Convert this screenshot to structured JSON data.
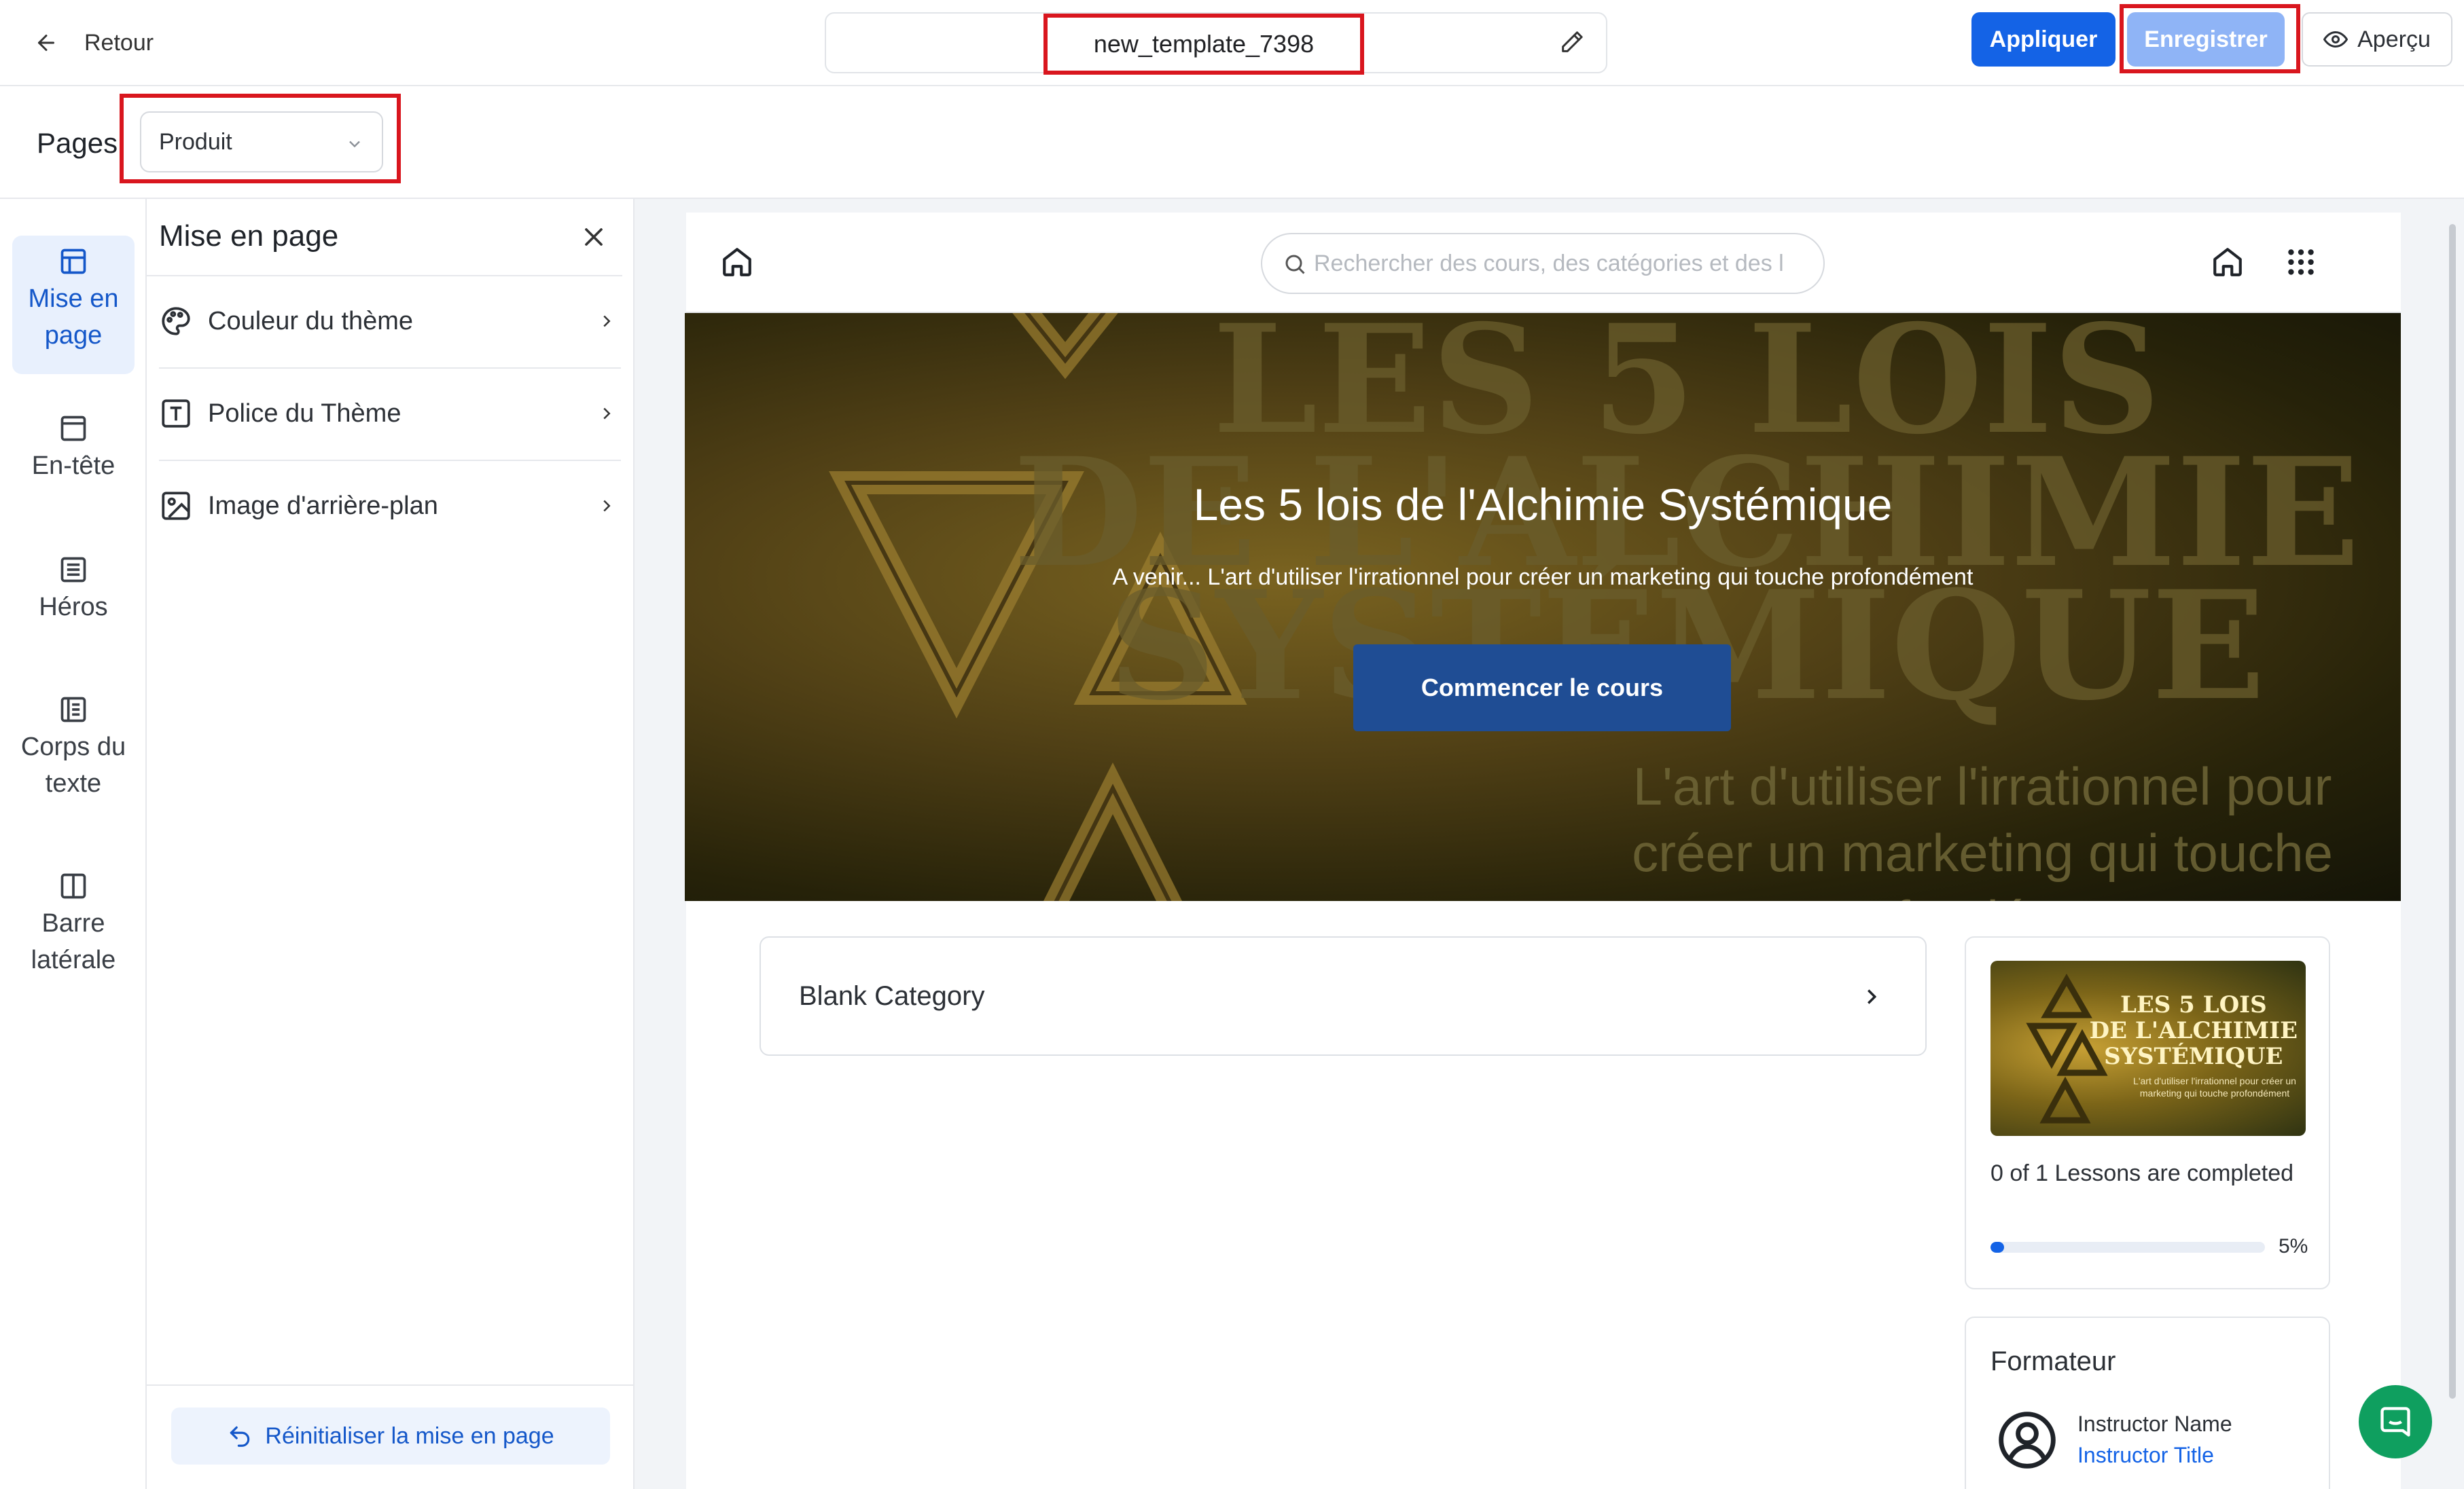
{
  "topbar": {
    "back_label": "Retour",
    "template_name": "new_template_7398",
    "apply_label": "Appliquer",
    "save_label": "Enregistrer",
    "preview_label": "Aperçu"
  },
  "pages": {
    "label": "Pages",
    "selected": "Produit"
  },
  "rail": {
    "items": [
      {
        "label": "Mise en page",
        "icon": "layout-icon",
        "active": true
      },
      {
        "label": "En-tête",
        "icon": "header-icon"
      },
      {
        "label": "Héros",
        "icon": "hero-icon"
      },
      {
        "label": "Corps du texte",
        "icon": "body-text-icon"
      },
      {
        "label": "Barre latérale",
        "icon": "sidebar-icon"
      }
    ]
  },
  "panel": {
    "title": "Mise en page",
    "rows": [
      {
        "label": "Couleur du thème",
        "icon": "palette-icon"
      },
      {
        "label": "Police du Thème",
        "icon": "font-icon"
      },
      {
        "label": "Image d'arrière-plan",
        "icon": "image-icon"
      }
    ],
    "reset_label": "Réinitialiser la mise en page"
  },
  "site": {
    "search_placeholder": "Rechercher des cours, des catégories et des l",
    "hero": {
      "bg_title_lines": [
        "LES 5 LOIS",
        "DE L'ALCHIMIE",
        "SYSTÉMIQUE"
      ],
      "bg_sub_lines": [
        "L'art d'utiliser l'irrationnel pour",
        "créer un marketing qui touche",
        "profondément"
      ],
      "title": "Les 5 lois de l'Alchimie Systémique",
      "subtitle": "A venir... L'art d'utiliser l'irrationnel pour créer un marketing qui touche profondément",
      "cta": "Commencer le cours"
    },
    "category": "Blank Category",
    "progress": {
      "thumb_title_lines": [
        "LES 5 LOIS",
        "DE L'ALCHIMIE",
        "SYSTÉMIQUE"
      ],
      "thumb_sub": "L'art d'utiliser l'irrationnel pour créer un marketing qui touche profondément",
      "text": "0 of 1 Lessons are completed",
      "percent": 5,
      "percent_label": "5%"
    },
    "instructor": {
      "section_title": "Formateur",
      "name": "Instructor Name",
      "title": "Instructor Title"
    }
  },
  "colors": {
    "primary": "#1463e6",
    "save_disabled": "#8fb4f6",
    "highlight": "#d9161e",
    "hero_button": "#1f4d94",
    "chat": "#0f9f5f"
  }
}
